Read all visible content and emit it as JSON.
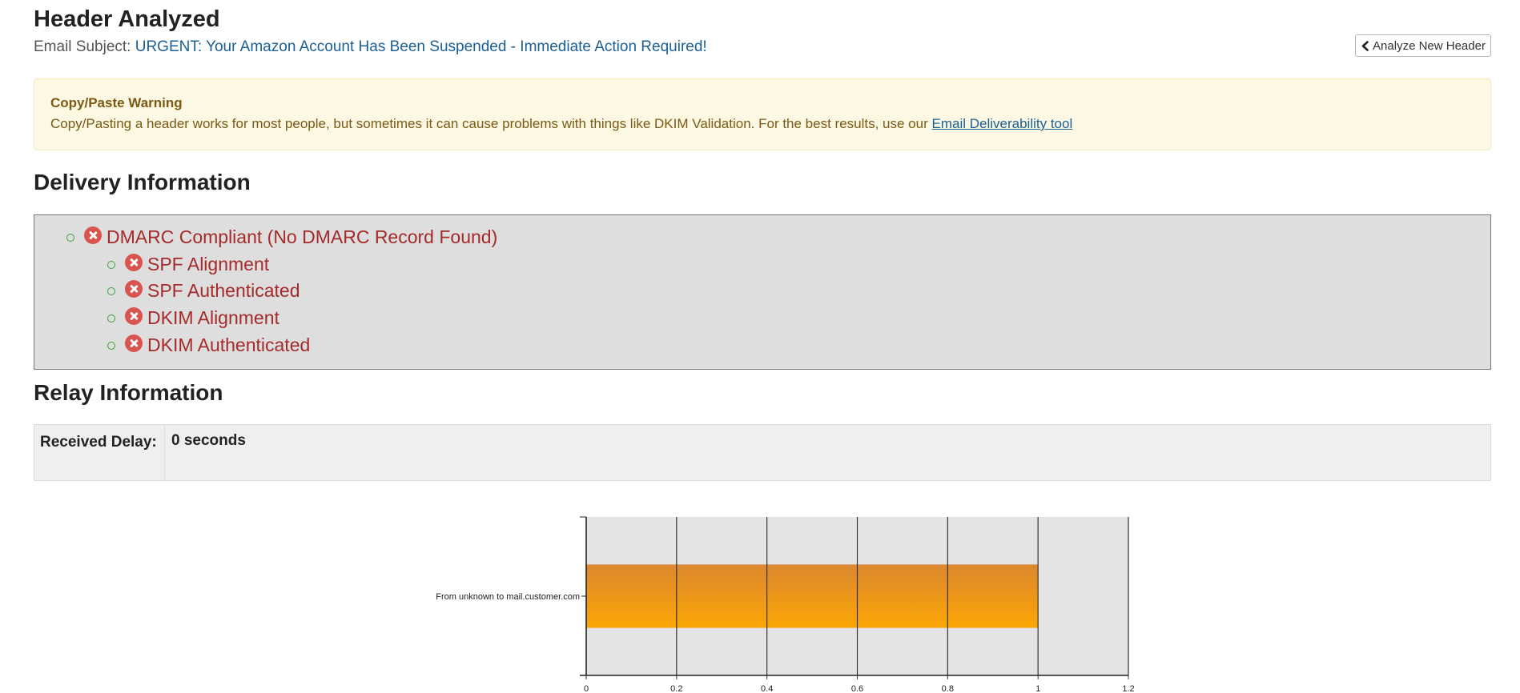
{
  "header": {
    "title": "Header Analyzed",
    "subject_label": "Email Subject:",
    "subject_value": "URGENT: Your Amazon Account Has Been Suspended - Immediate Action Required!",
    "analyze_button": "Analyze New Header",
    "analyze_icon": "chevron-left-icon"
  },
  "warning": {
    "title": "Copy/Paste Warning",
    "text": "Copy/Pasting a header works for most people, but sometimes it can cause problems with things like DKIM Validation. For the best results, use our",
    "link": "Email Deliverability tool"
  },
  "delivery": {
    "heading": "Delivery Information",
    "status_icon": "error-x-icon",
    "items": [
      {
        "label": "DMARC Compliant (No DMARC Record Found)",
        "level": 0
      },
      {
        "label": "SPF Alignment",
        "level": 1
      },
      {
        "label": "SPF Authenticated",
        "level": 1
      },
      {
        "label": "DKIM Alignment",
        "level": 1
      },
      {
        "label": "DKIM Authenticated",
        "level": 1
      }
    ]
  },
  "relay": {
    "heading": "Relay Information",
    "received_delay_label": "Received Delay:",
    "received_delay_value": "0 seconds"
  },
  "colors": {
    "error": "#a52a2a",
    "error_icon": "#d9534f",
    "link": "#1a5f96",
    "warning_bg": "#fcf8e3",
    "warning_text": "#7a5a14",
    "bar_top": "#dd8730",
    "bar_bottom": "#fba604",
    "plot_bg": "#e4e4e6"
  },
  "chart_data": {
    "type": "bar",
    "orientation": "horizontal",
    "categories": [
      "From unknown to mail.customer.com"
    ],
    "values": [
      1
    ],
    "xlim": [
      0,
      1.2
    ],
    "xticks": [
      "0",
      "0.2",
      "0.4",
      "0.6",
      "0.8",
      "1",
      "1.2"
    ],
    "grid": true
  }
}
